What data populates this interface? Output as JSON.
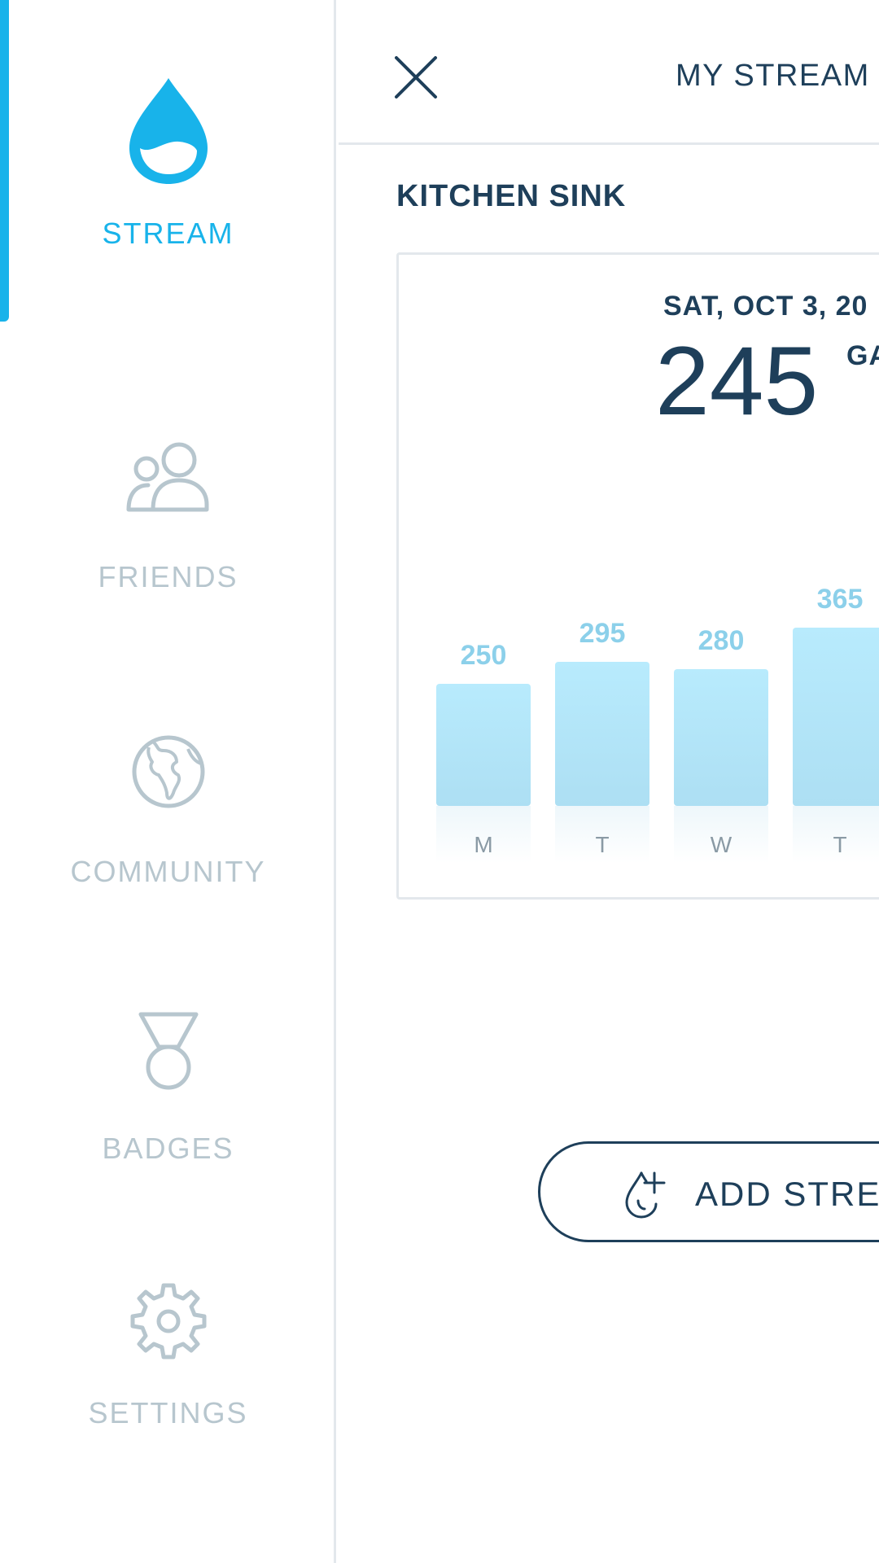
{
  "sidebar": {
    "items": [
      {
        "label": "STREAM",
        "icon": "water-drop-icon",
        "active": true
      },
      {
        "label": "FRIENDS",
        "icon": "people-icon",
        "active": false
      },
      {
        "label": "COMMUNITY",
        "icon": "globe-icon",
        "active": false
      },
      {
        "label": "BADGES",
        "icon": "medal-icon",
        "active": false
      },
      {
        "label": "SETTINGS",
        "icon": "gear-icon",
        "active": false
      }
    ]
  },
  "header": {
    "title": "MY STREAM",
    "close_icon": "close-icon"
  },
  "section": {
    "title": "KITCHEN SINK"
  },
  "card": {
    "date": "SAT, OCT 3, 20",
    "value": "245",
    "unit": "GA"
  },
  "chart_data": {
    "type": "bar",
    "categories": [
      "M",
      "T",
      "W",
      "T"
    ],
    "values": [
      250,
      295,
      280,
      365
    ],
    "title": "",
    "xlabel": "",
    "ylabel": ""
  },
  "add_button": {
    "label": "ADD STRE",
    "icon": "drop-plus-icon"
  },
  "colors": {
    "accent": "#18b3ea",
    "navy": "#1e3f5a",
    "inactive": "#b7c6ce",
    "bar": "#b3e6f8",
    "bar_label": "#8cd0ea",
    "border": "#e3e8ec"
  }
}
